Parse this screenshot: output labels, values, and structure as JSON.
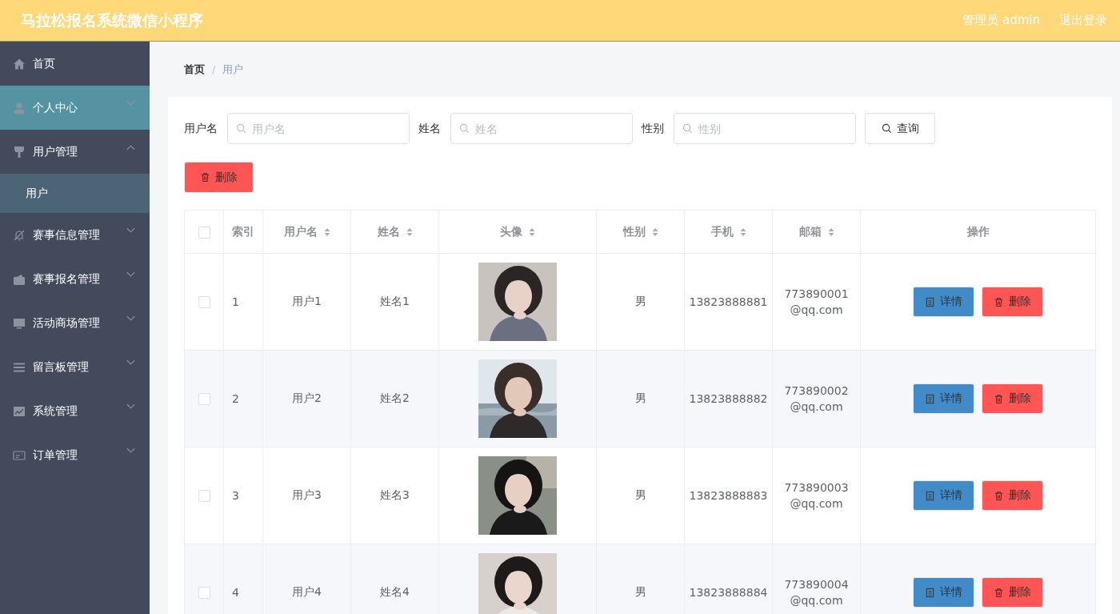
{
  "header": {
    "title": "马拉松报名系统微信小程序",
    "user": "管理员 admin",
    "logout": "退出登录"
  },
  "sidebar": {
    "items": [
      {
        "label": "首页",
        "selected": false,
        "hovered": false
      },
      {
        "label": "个人中心",
        "selected": false,
        "hovered": true,
        "expanded": false
      },
      {
        "label": "用户管理",
        "selected": false,
        "hovered": false,
        "expanded": true,
        "children": [
          {
            "label": "用户",
            "selected": true
          }
        ]
      },
      {
        "label": "赛事信息管理",
        "selected": false,
        "hovered": false,
        "expanded": false
      },
      {
        "label": "赛事报名管理",
        "selected": false,
        "hovered": false,
        "expanded": false
      },
      {
        "label": "活动商场管理",
        "selected": false,
        "hovered": false,
        "expanded": false
      },
      {
        "label": "留言板管理",
        "selected": false,
        "hovered": false,
        "expanded": false
      },
      {
        "label": "系统管理",
        "selected": false,
        "hovered": false,
        "expanded": false
      },
      {
        "label": "订单管理",
        "selected": false,
        "hovered": false,
        "expanded": false
      }
    ]
  },
  "breadcrumb": [
    "首页",
    "用户"
  ],
  "breadcrumb_separator": "/",
  "filters": [
    {
      "label": "用户名",
      "placeholder": "用户名"
    },
    {
      "label": "姓名",
      "placeholder": "姓名"
    },
    {
      "label": "性别",
      "placeholder": "性别"
    }
  ],
  "search_button": "查询",
  "delete_button": "删除",
  "table": {
    "all_checked": false,
    "columns": [
      {
        "label": "索引",
        "sortable": false
      },
      {
        "label": "用户名",
        "sortable": true
      },
      {
        "label": "姓名",
        "sortable": true
      },
      {
        "label": "头像",
        "sortable": true
      },
      {
        "label": "性别",
        "sortable": true
      },
      {
        "label": "手机",
        "sortable": true
      },
      {
        "label": "邮箱",
        "sortable": true
      },
      {
        "label": "操作",
        "sortable": false
      }
    ],
    "rows": [
      {
        "checked": false,
        "index": "1",
        "username": "用户1",
        "name": "姓名1",
        "avatar": {
          "kind": "picture"
        },
        "gender": "男",
        "phone": "13823888881",
        "email": "773890001@qq.com",
        "actions": [
          "详情",
          "删除"
        ]
      },
      {
        "checked": false,
        "index": "2",
        "username": "用户2",
        "name": "姓名2",
        "avatar": {
          "kind": "picture"
        },
        "gender": "男",
        "phone": "13823888882",
        "email": "773890002@qq.com",
        "actions": [
          "详情",
          "删除"
        ]
      },
      {
        "checked": false,
        "index": "3",
        "username": "用户3",
        "name": "姓名3",
        "avatar": {
          "kind": "picture"
        },
        "gender": "男",
        "phone": "13823888883",
        "email": "773890003@qq.com",
        "actions": [
          "详情",
          "删除"
        ]
      },
      {
        "checked": false,
        "index": "4",
        "username": "用户4",
        "name": "姓名4",
        "avatar": {
          "kind": "picture"
        },
        "gender": "男",
        "phone": "13823888884",
        "email": "773890004@qq.com",
        "actions": [
          "详情",
          "删除"
        ]
      }
    ]
  }
}
